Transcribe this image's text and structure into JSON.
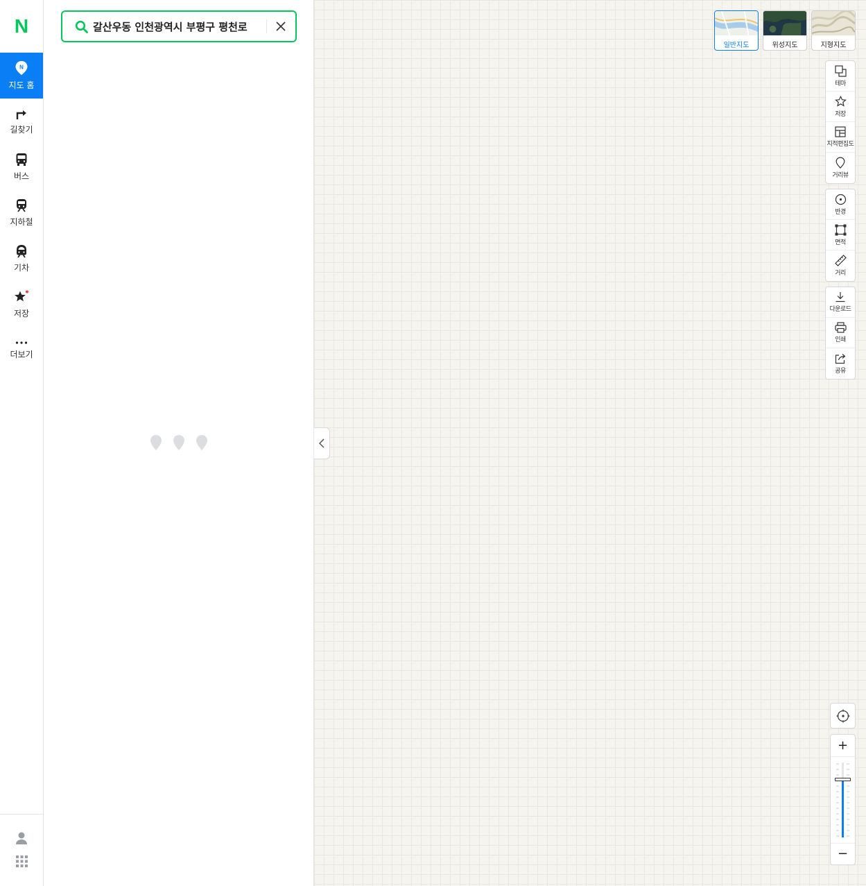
{
  "nav": {
    "logo": "N",
    "items": [
      {
        "label": "지도 홈",
        "icon": "map-home-pin-icon"
      },
      {
        "label": "길찾기",
        "icon": "directions-arrow-icon"
      },
      {
        "label": "버스",
        "icon": "bus-icon"
      },
      {
        "label": "지하철",
        "icon": "subway-icon"
      },
      {
        "label": "기차",
        "icon": "train-icon"
      },
      {
        "label": "저장",
        "icon": "star-icon"
      },
      {
        "label": "더보기",
        "icon": "more-dots-icon"
      }
    ],
    "bottom": [
      {
        "icon": "user-icon"
      },
      {
        "icon": "apps-grid-icon"
      }
    ]
  },
  "search": {
    "query": "갈산우동 인천광역시 부평구 평천로"
  },
  "map_types": [
    {
      "label": "일반지도",
      "active": true
    },
    {
      "label": "위성지도",
      "active": false
    },
    {
      "label": "지형지도",
      "active": false
    }
  ],
  "tools": {
    "group1": [
      {
        "label": "테마",
        "icon": "theme-layers-icon"
      },
      {
        "label": "저장",
        "icon": "star-outline-icon"
      },
      {
        "label": "지적편집도",
        "icon": "cadastral-map-icon"
      },
      {
        "label": "거리뷰",
        "icon": "street-view-pin-icon"
      }
    ],
    "group2": [
      {
        "label": "반경",
        "icon": "radius-circle-icon"
      },
      {
        "label": "면적",
        "icon": "area-square-icon"
      },
      {
        "label": "거리",
        "icon": "ruler-icon"
      }
    ],
    "group3": [
      {
        "label": "다운로드",
        "icon": "download-icon"
      },
      {
        "label": "인쇄",
        "icon": "print-icon"
      },
      {
        "label": "공유",
        "icon": "share-icon"
      }
    ]
  },
  "zoom": {
    "in": "+",
    "out": "−",
    "level_fraction": 0.78
  },
  "colors": {
    "brand": "#03c75a",
    "accent": "#0a7ef5"
  }
}
